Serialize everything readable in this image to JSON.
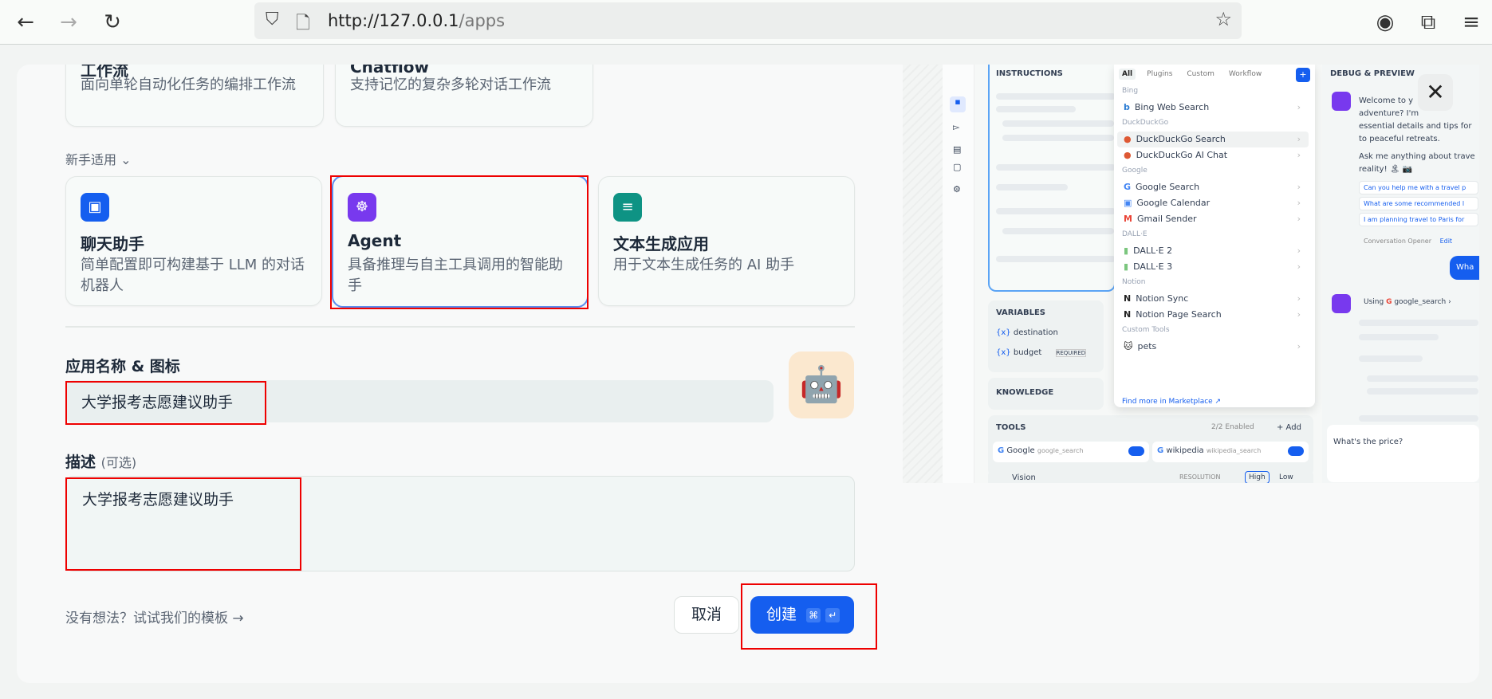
{
  "browser": {
    "url_host": "http://127.0.0.1",
    "url_path": "/apps",
    "back_icon": "arrow-left",
    "forward_icon": "arrow-right",
    "reload_icon": "reload",
    "shield_icon": "shield",
    "page_icon": "page",
    "star_icon": "star",
    "account_icon": "account",
    "extensions_icon": "puzzle",
    "menu_icon": "hamburger"
  },
  "top_cards": [
    {
      "title": "工作流",
      "desc": "面向单轮自动化任务的编排工作流"
    },
    {
      "title": "Chatflow",
      "desc": "支持记忆的复杂多轮对话工作流"
    }
  ],
  "section_label": "新手适用",
  "beginner_cards": [
    {
      "title": "聊天助手",
      "desc": "简单配置即可构建基于 LLM 的对话机器人",
      "color": "#155eef",
      "icon": "chat-bot"
    },
    {
      "title": "Agent",
      "desc": "具备推理与自主工具调用的智能助手",
      "color": "#7839ee",
      "icon": "agent-brain"
    },
    {
      "title": "文本生成应用",
      "desc": "用于文本生成任务的 AI 助手",
      "color": "#0e9384",
      "icon": "text-sparkle"
    }
  ],
  "form": {
    "name_label": "应用名称 & 图标",
    "name_value": "大学报考志愿建议助手",
    "app_icon": "robot-emoji",
    "desc_label": "描述",
    "desc_optional": "(可选)",
    "desc_value": "大学报考志愿建议助手"
  },
  "footer": {
    "template_link": "没有想法？试试我们的模板",
    "cancel": "取消",
    "create": "创建",
    "shortcut_cmd": "⌘",
    "shortcut_enter": "↵"
  },
  "preview": {
    "instructions": "INSTRUCTIONS",
    "tabs": [
      "All",
      "Plugins",
      "Custom",
      "Workflow"
    ],
    "groups": [
      {
        "name": "Bing",
        "items": [
          "Bing Web Search"
        ]
      },
      {
        "name": "DuckDuckGo",
        "items": [
          "DuckDuckGo Search",
          "DuckDuckGo AI Chat"
        ]
      },
      {
        "name": "Google",
        "items": [
          "Google Search",
          "Google Calendar",
          "Gmail Sender"
        ]
      },
      {
        "name": "DALL·E",
        "items": [
          "DALL·E 2",
          "DALL·E 3"
        ]
      },
      {
        "name": "Notion",
        "items": [
          "Notion Sync",
          "Notion Page Search"
        ]
      },
      {
        "name": "Custom Tools",
        "items": [
          "pets"
        ]
      }
    ],
    "marketplace": "Find more in Marketplace ↗",
    "variables": "VARIABLES",
    "var1": "destination",
    "var2": "budget",
    "required": "REQUIRED",
    "knowledge": "KNOWLEDGE",
    "tools": "TOOLS",
    "enabled": "2/2 Enabled",
    "add": "+ Add",
    "tool1": "Google",
    "tool1_id": "google_search",
    "tool2": "wikipedia",
    "tool2_id": "wikipedia_search",
    "vision": "Vision",
    "resolution": "RESOLUTION",
    "high": "High",
    "low": "Low",
    "debug": "DEBUG & PREVIEW",
    "welcome": [
      "Welcome to y",
      "adventure? I'm",
      "essential details and tips for",
      "to peaceful retreats."
    ],
    "ask": "Ask me anything about trave",
    "reality": "reality! 🏝 📷",
    "suggestions": [
      "Can you help me with a travel p",
      "What are some recommended l",
      "I am planning travel to Paris for"
    ],
    "opener": "Conversation Opener",
    "edit": "Edit",
    "user_msg": "Wha",
    "using": "Using",
    "using_tool": "google_search",
    "input": "What's the price?"
  }
}
